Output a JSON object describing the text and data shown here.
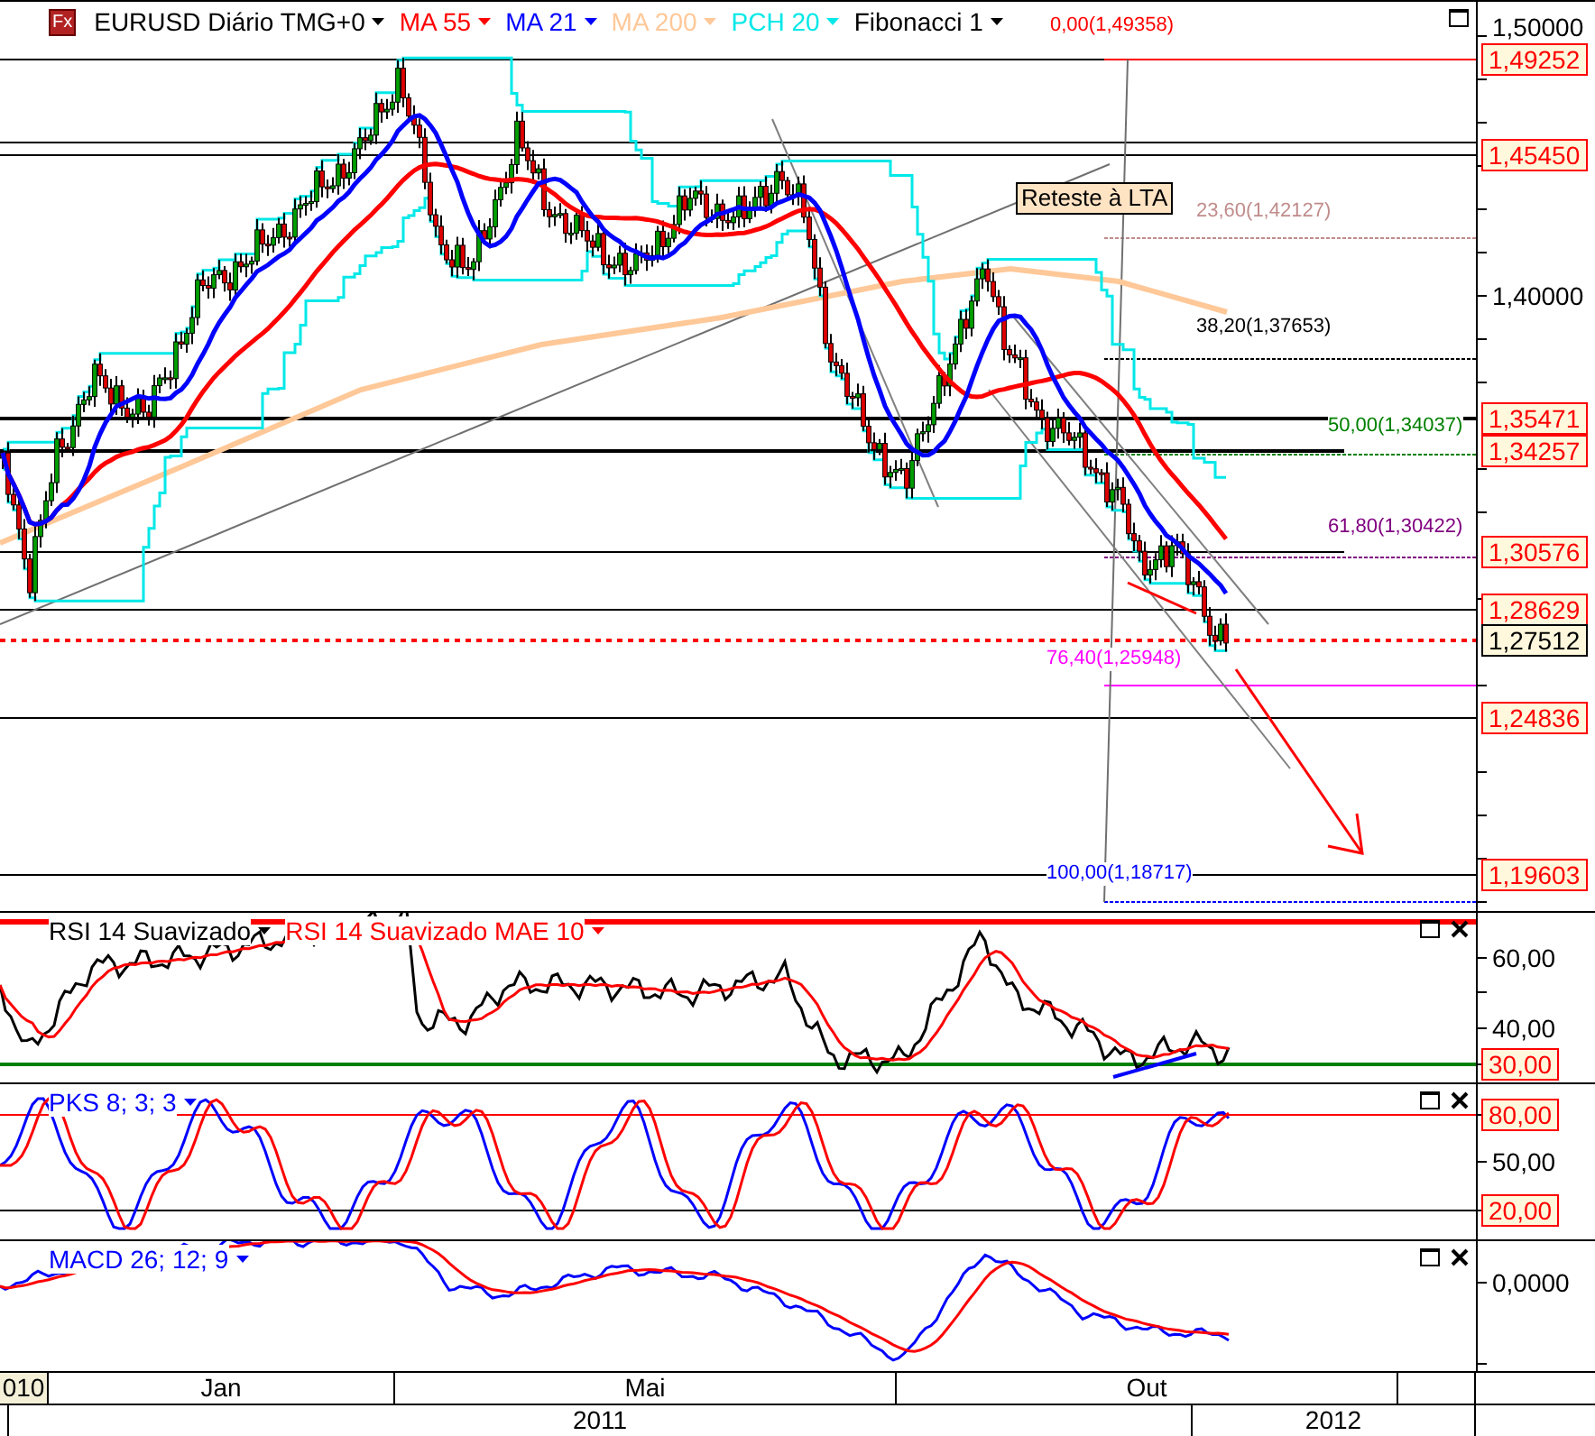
{
  "price_panel": {
    "logo_text": "Fx",
    "legend": [
      {
        "label": "EURUSD Diário TMG+0",
        "color": "#000000"
      },
      {
        "label": "MA 55",
        "color": "#ff0000"
      },
      {
        "label": "MA 21",
        "color": "#0000ff"
      },
      {
        "label": "MA 200",
        "color": "#ffc898"
      },
      {
        "label": "PCH 20",
        "color": "#00e8e8"
      },
      {
        "label": "Fibonacci 1",
        "color": "#000000"
      }
    ],
    "annotation": "Reteste à LTA",
    "fib_levels": [
      {
        "label": "0,00(1,49358)",
        "color": "#ff0000"
      },
      {
        "label": "23,60(1,42127)",
        "color": "#c08c8c"
      },
      {
        "label": "38,20(1,37653)",
        "color": "#000000"
      },
      {
        "label": "50,00(1,34037)",
        "color": "#008000"
      },
      {
        "label": "61,80(1,30422)",
        "color": "#800080"
      },
      {
        "label": "76,40(1,25948)",
        "color": "#ff00ff"
      },
      {
        "label": "100,00(1,18717)",
        "color": "#0000ff"
      }
    ],
    "axis_labels": [
      "1,50000",
      "1,40000"
    ],
    "price_tags": [
      {
        "text": "1,49252",
        "kind": "level"
      },
      {
        "text": "1,45450",
        "kind": "level"
      },
      {
        "text": "1,35471",
        "kind": "level"
      },
      {
        "text": "1,34257",
        "kind": "level"
      },
      {
        "text": "1,30576",
        "kind": "level"
      },
      {
        "text": "1,28629",
        "kind": "level"
      },
      {
        "text": "1,27512",
        "kind": "current"
      },
      {
        "text": "1,24836",
        "kind": "level"
      },
      {
        "text": "1,19603",
        "kind": "level"
      }
    ]
  },
  "rsi_panel": {
    "titles": [
      {
        "label": "RSI 14 Suavizado",
        "color": "#000000"
      },
      {
        "label": "RSI 14 Suavizado MAE 10",
        "color": "#ff0000"
      }
    ],
    "axis_labels": [
      "60,00",
      "40,00"
    ],
    "price_tags": [
      {
        "text": "30,00",
        "kind": "level"
      }
    ]
  },
  "pks_panel": {
    "titles": [
      {
        "label": "PKS 8; 3; 3",
        "color": "#0000ff"
      }
    ],
    "axis_labels": [
      "50,00"
    ],
    "price_tags": [
      {
        "text": "80,00",
        "kind": "level"
      },
      {
        "text": "20,00",
        "kind": "level"
      }
    ]
  },
  "macd_panel": {
    "titles": [
      {
        "label": "MACD 26; 12; 9",
        "color": "#0000ff"
      }
    ],
    "axis_labels": [
      "0,0000"
    ]
  },
  "time_axis": {
    "months": [
      "010",
      "Jan",
      "Mai",
      "Out"
    ],
    "years": [
      "2011",
      "2012"
    ]
  }
}
